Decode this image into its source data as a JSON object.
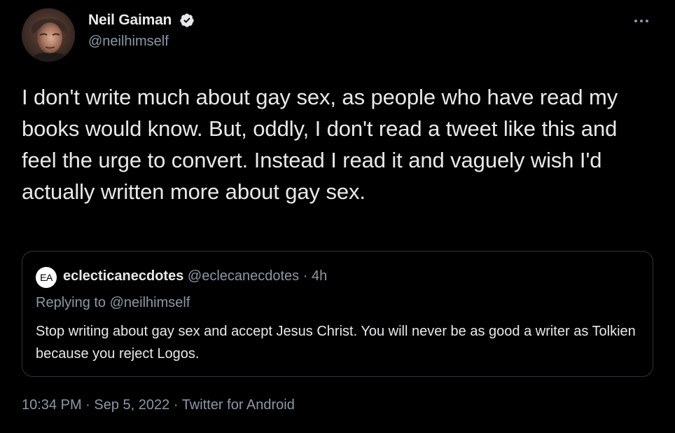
{
  "author": {
    "display_name": "Neil Gaiman",
    "handle": "@neilhimself",
    "verified": true,
    "avatar_icon": "author-photo"
  },
  "tweet": {
    "text": "I don't write much about gay sex, as people who have read my books would know. But, oddly, I don't read a tweet like this and feel the urge to convert. Instead I read it and vaguely wish I'd actually written more about gay sex."
  },
  "quoted_tweet": {
    "avatar_initials": "EA",
    "display_name": "eclecticanecdotes",
    "meta": "@eclecanecdotes · 4h",
    "replying_to": "Replying to @neilhimself",
    "text": "Stop writing about gay sex and accept Jesus Christ. You will never be as good a writer as Tolkien because you reject Logos."
  },
  "footer": {
    "time": "10:34 PM",
    "separator1": " · ",
    "date": "Sep 5, 2022",
    "separator2": " · ",
    "source": "Twitter for Android"
  },
  "colors": {
    "background": "#000000",
    "primary_text": "#e7e9ea",
    "secondary_text": "#8b98a5",
    "border": "#2f3336"
  }
}
